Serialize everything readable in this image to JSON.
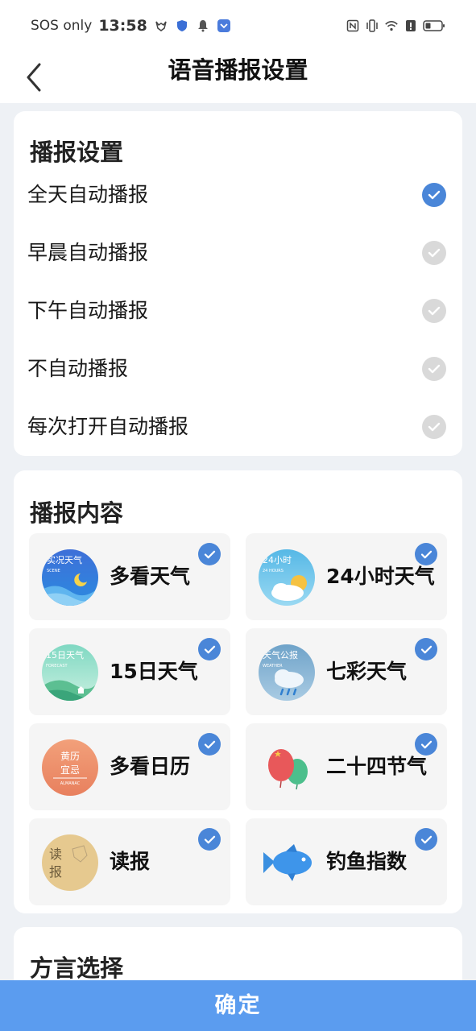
{
  "status_bar": {
    "network": "SOS only",
    "time": "13:58"
  },
  "header": {
    "title": "语音播报设置"
  },
  "broadcast_settings": {
    "title": "播报设置",
    "options": [
      {
        "label": "全天自动播报",
        "selected": true
      },
      {
        "label": "早晨自动播报",
        "selected": false
      },
      {
        "label": "下午自动播报",
        "selected": false
      },
      {
        "label": "不自动播报",
        "selected": false
      },
      {
        "label": "每次打开自动播报",
        "selected": false
      }
    ]
  },
  "broadcast_content": {
    "title": "播报内容",
    "items": [
      {
        "label": "多看天气",
        "icon": "live-weather-icon",
        "icon_text": "实况天气",
        "icon_sub": "SCENE",
        "checked": true
      },
      {
        "label": "24小时天气",
        "icon": "24h-weather-icon",
        "icon_text": "24小时",
        "icon_sub": "24 HOURS",
        "checked": true
      },
      {
        "label": "15日天气",
        "icon": "15day-weather-icon",
        "icon_text": "15日天气",
        "icon_sub": "FORECAST",
        "checked": true
      },
      {
        "label": "七彩天气",
        "icon": "colorful-weather-icon",
        "icon_text": "天气公报",
        "icon_sub": "WEATHER",
        "checked": true
      },
      {
        "label": "多看日历",
        "icon": "almanac-icon",
        "icon_text": "黄历",
        "icon_text2": "宜忌",
        "icon_sub": "ALMANAC",
        "checked": true
      },
      {
        "label": "二十四节气",
        "icon": "balloon-icon",
        "checked": true
      },
      {
        "label": "读报",
        "icon": "newspaper-icon",
        "icon_text": "读",
        "icon_text2": "报",
        "checked": true
      },
      {
        "label": "钓鱼指数",
        "icon": "fish-icon",
        "checked": true
      }
    ]
  },
  "dialect": {
    "title": "方言选择"
  },
  "footer": {
    "confirm_label": "确定"
  },
  "colors": {
    "accent": "#4a86d8",
    "confirm_bg": "#5b9cef",
    "unchecked": "#d9d9d9",
    "page_bg": "#eef1f5"
  }
}
